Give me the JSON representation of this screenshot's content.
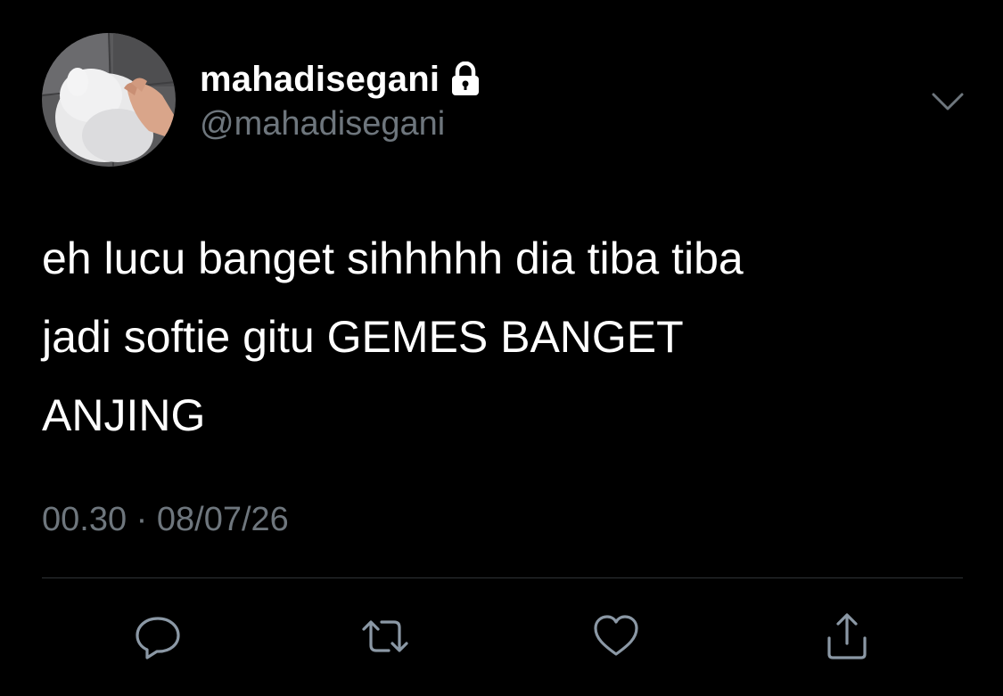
{
  "user": {
    "display_name": "mahadisegani",
    "handle": "@mahadisegani",
    "protected_icon": "lock-icon",
    "avatar": "profile-photo"
  },
  "tweet": {
    "text": "eh lucu banget sihhhhh dia tiba tiba\njadi softie gitu GEMES BANGET\nANJING",
    "time": "00.30",
    "separator": "·",
    "date": "08/07/26"
  },
  "actions": [
    {
      "name": "reply",
      "icon": "reply-icon"
    },
    {
      "name": "retweet",
      "icon": "retweet-icon"
    },
    {
      "name": "like",
      "icon": "heart-icon"
    },
    {
      "name": "share",
      "icon": "share-icon"
    }
  ],
  "colors": {
    "background": "#000000",
    "primary_text": "#ffffff",
    "secondary_text": "#6e767d",
    "divider": "#2f3336",
    "icon": "#8b98a5"
  }
}
